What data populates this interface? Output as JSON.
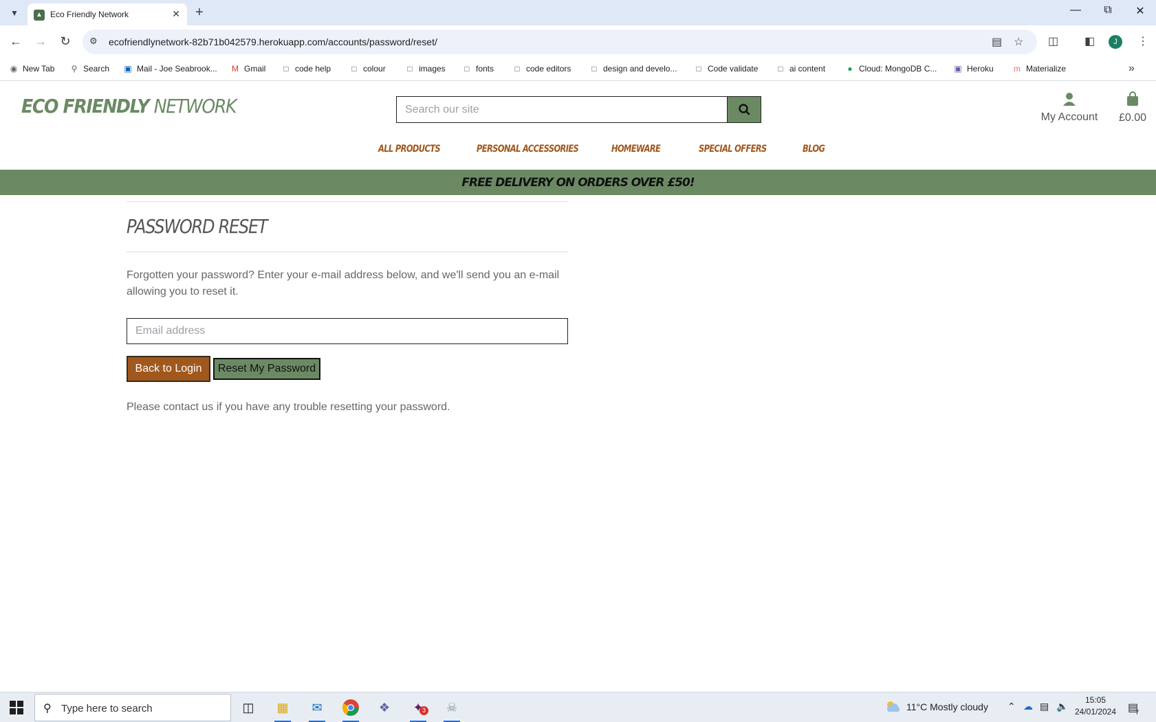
{
  "browser": {
    "tab_title": "Eco Friendly Network",
    "url": "ecofriendlynetwork-82b71b042579.herokuapp.com/accounts/password/reset/",
    "profile_initial": "J",
    "bookmarks": [
      {
        "label": "New Tab",
        "icon": "globe-icon"
      },
      {
        "label": "Search",
        "icon": "search-icon"
      },
      {
        "label": "Mail - Joe Seabrook...",
        "icon": "outlook-icon"
      },
      {
        "label": "Gmail",
        "icon": "gmail-icon"
      },
      {
        "label": "code help",
        "icon": "folder-icon"
      },
      {
        "label": "colour",
        "icon": "folder-icon"
      },
      {
        "label": "images",
        "icon": "folder-icon"
      },
      {
        "label": "fonts",
        "icon": "folder-icon"
      },
      {
        "label": "code editors",
        "icon": "folder-icon"
      },
      {
        "label": "design and develo...",
        "icon": "folder-icon"
      },
      {
        "label": "Code validate",
        "icon": "folder-icon"
      },
      {
        "label": "ai content",
        "icon": "folder-icon"
      },
      {
        "label": "Cloud: MongoDB C...",
        "icon": "mongodb-icon"
      },
      {
        "label": "Heroku",
        "icon": "heroku-icon"
      },
      {
        "label": "Materialize",
        "icon": "materialize-icon"
      }
    ]
  },
  "site": {
    "logo_bold": "ECO FRIENDLY ",
    "logo_light": "NETWORK",
    "search_placeholder": "Search our site",
    "account_label": "My Account",
    "bag_total": "£0.00",
    "nav": [
      "ALL PRODUCTS",
      "PERSONAL ACCESSORIES",
      "HOMEWARE",
      "SPECIAL OFFERS",
      "BLOG"
    ],
    "banner": "FREE DELIVERY ON ORDERS OVER £50!",
    "colors": {
      "brand_green": "#6b8a64",
      "accent_brown": "#a0581d"
    }
  },
  "page": {
    "title": "PASSWORD RESET",
    "intro": "Forgotten your password? Enter your e-mail address below, and we'll send you an e-mail allowing you to reset it.",
    "email_placeholder": "Email address",
    "back_button": "Back to Login",
    "reset_button": "Reset My Password",
    "help_text": "Please contact us if you have any trouble resetting your password."
  },
  "taskbar": {
    "search_placeholder": "Type here to search",
    "weather": "11°C  Mostly cloudy",
    "time": "15:05",
    "date": "24/01/2024",
    "slack_badge": "3",
    "notification_count": "7"
  }
}
